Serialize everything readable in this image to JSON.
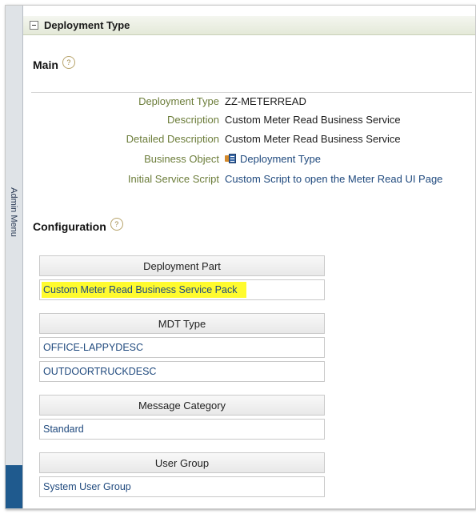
{
  "sidebar": {
    "label": "Admin Menu"
  },
  "section": {
    "title": "Deployment Type"
  },
  "main": {
    "heading": "Main",
    "fields": [
      {
        "label": "Deployment Type",
        "value": "ZZ-METERREAD"
      },
      {
        "label": "Description",
        "value": "Custom Meter Read Business Service"
      },
      {
        "label": "Detailed Description",
        "value": "Custom Meter Read Business Service"
      },
      {
        "label": "Business Object",
        "value": "Deployment Type"
      },
      {
        "label": "Initial Service Script",
        "value": "Custom Script to open the Meter Read UI Page"
      }
    ]
  },
  "configuration": {
    "heading": "Configuration",
    "tables": [
      {
        "header": "Deployment Part",
        "rows": [
          "Custom Meter Read Business Service Pack"
        ]
      },
      {
        "header": "MDT Type",
        "rows": [
          "OFFICE-LAPPYDESC",
          "OUTDOORTRUCKDESC"
        ]
      },
      {
        "header": "Message Category",
        "rows": [
          "Standard"
        ]
      },
      {
        "header": "User Group",
        "rows": [
          "System User Group"
        ]
      }
    ]
  },
  "colors": {
    "label": "#6c7d3a",
    "link": "#204a7e",
    "highlight": "#fffb2e",
    "sidebar_accent": "#1f5a8e"
  }
}
